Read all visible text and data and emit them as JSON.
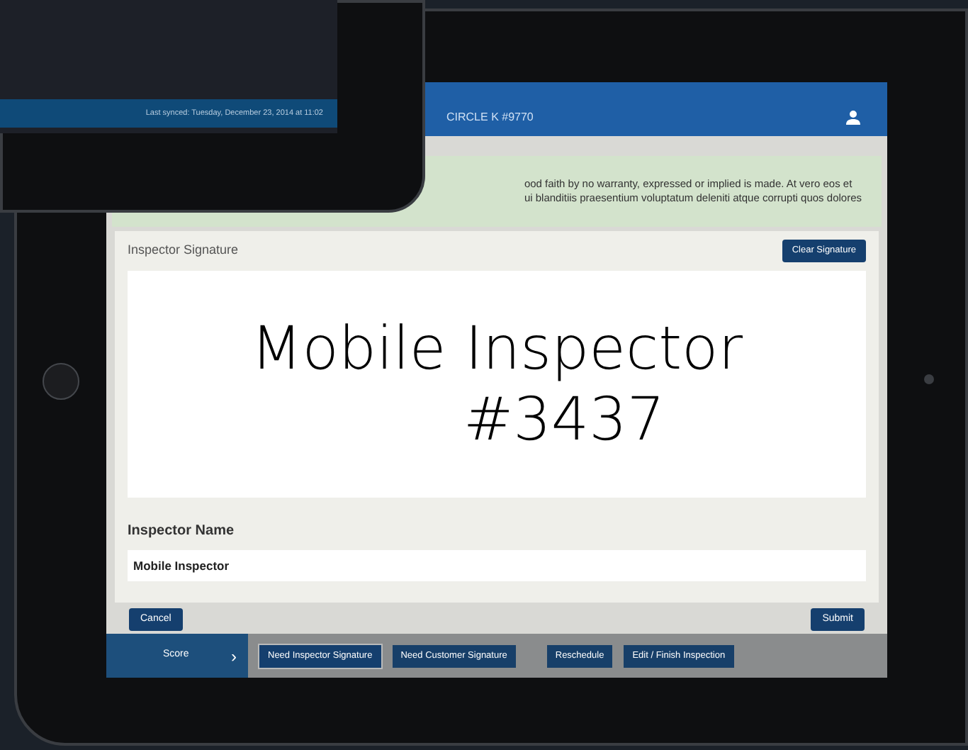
{
  "back_tablet": {
    "sync_status": "Last synced: Tuesday, December 23, 2014 at 11:02"
  },
  "nav_bar": {
    "title": "CIRCLE K #9770"
  },
  "notice": [
    "ood faith by no warranty, expressed or implied is made. At vero eos et",
    "ui blanditiis praesentium voluptatum deleniti atque corrupti quos dolores"
  ],
  "signature_panel": {
    "title": "Inspector Signature",
    "clear_button": "Clear Signature",
    "signature_lines": [
      "Mobile Inspector",
      "#3437"
    ]
  },
  "name_field": {
    "label": "Inspector Name",
    "value": "Mobile Inspector"
  },
  "actions": [
    "Cancel",
    "Submit"
  ],
  "bottom_bar": {
    "score_tab": "Score",
    "score_arrow": "›",
    "buttons": [
      {
        "label": "Need Inspector Signature",
        "selected": true
      },
      {
        "label": "Need Customer Signature",
        "selected": false
      },
      {
        "label": "Reschedule",
        "selected": false
      },
      {
        "label": "Edit / Finish Inspection",
        "selected": false
      }
    ]
  }
}
